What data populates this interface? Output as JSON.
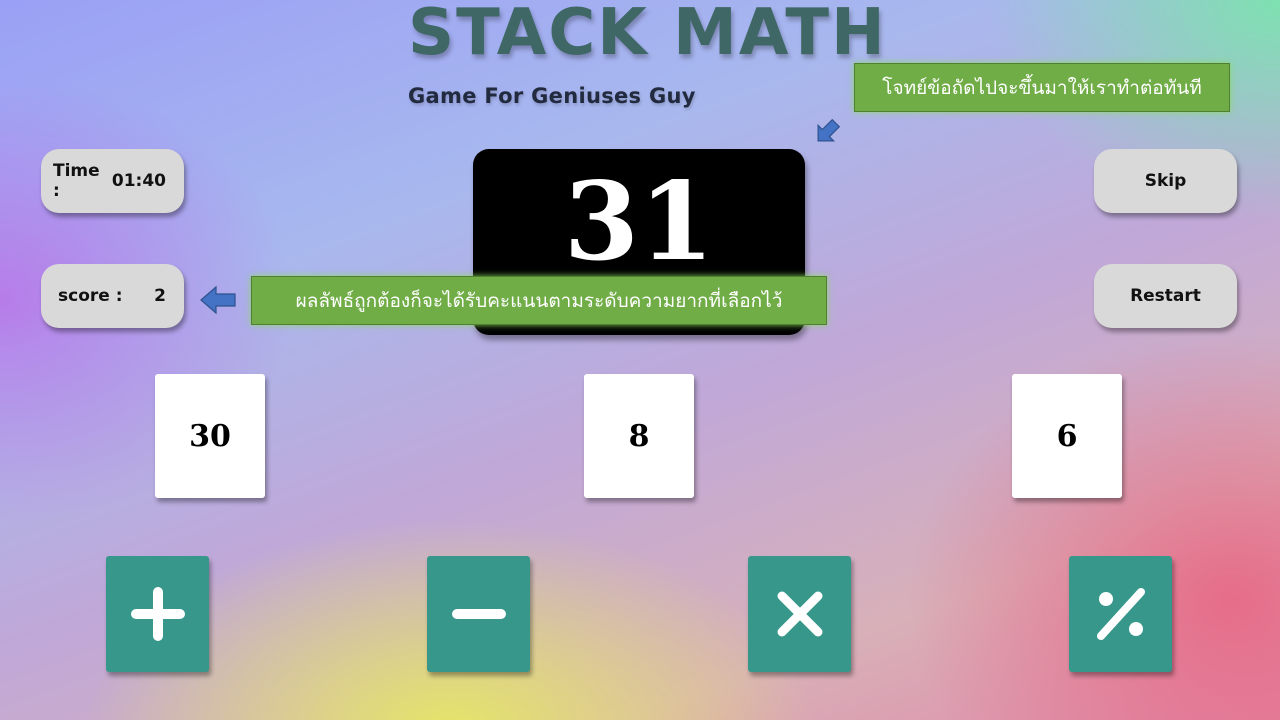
{
  "header": {
    "title": "STACK MATH",
    "subtitle": "Game For Geniuses Guy"
  },
  "stats": {
    "time_label": "Time :",
    "time_value": "01:40",
    "score_label": "score :",
    "score_value": "2"
  },
  "target": {
    "value": "31"
  },
  "buttons": {
    "skip": "Skip",
    "restart": "Restart"
  },
  "callouts": {
    "next_question": "โจทย์ข้อถัดไปจะขึ้นมาให้เราทำต่อทันที",
    "score_hint": "ผลลัพธ์ถูกต้องก็จะได้รับคะแนนตามระดับความยากที่เลือกไว้"
  },
  "cards": [
    {
      "value": "30"
    },
    {
      "value": "8"
    },
    {
      "value": "6"
    }
  ],
  "operators": [
    {
      "icon": "plus-icon"
    },
    {
      "icon": "minus-icon"
    },
    {
      "icon": "multiply-icon"
    },
    {
      "icon": "percent-icon"
    }
  ],
  "colors": {
    "title": "#3f6766",
    "operator_tile": "#36978a",
    "callout_bg": "#70ad47",
    "arrow": "#4472c4",
    "target_bg": "#000000"
  }
}
